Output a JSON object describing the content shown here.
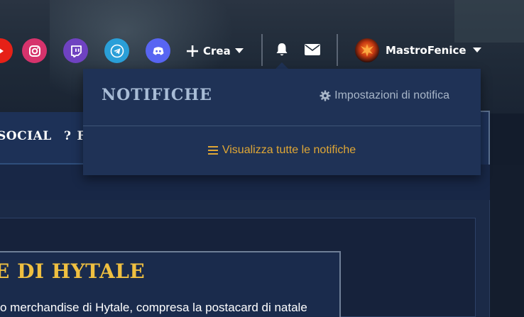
{
  "header": {
    "create_label": "Crea",
    "username": "MastroFenice"
  },
  "social_icons": [
    {
      "name": "youtube-icon",
      "color": "#e62117"
    },
    {
      "name": "instagram-icon",
      "color": "#d6336c"
    },
    {
      "name": "twitch-icon",
      "color": "#6f42c1"
    },
    {
      "name": "telegram-icon",
      "color": "#2a9fd8"
    },
    {
      "name": "discord-icon",
      "color": "#5865f2"
    }
  ],
  "notifications": {
    "title": "NOTIFICHE",
    "settings_label": "Impostazioni di notifica",
    "view_all_label": "Visualizza tutte le notifiche"
  },
  "nav": {
    "items": [
      "SOCIAL",
      "F"
    ]
  },
  "article": {
    "title": "E DI HYTALE",
    "excerpt": "o merchandise di Hytale, compresa la postacard di natale"
  },
  "colors": {
    "accent_gold": "#f0c040",
    "link_orange": "#e0a735",
    "panel_bg": "#1f3256"
  }
}
